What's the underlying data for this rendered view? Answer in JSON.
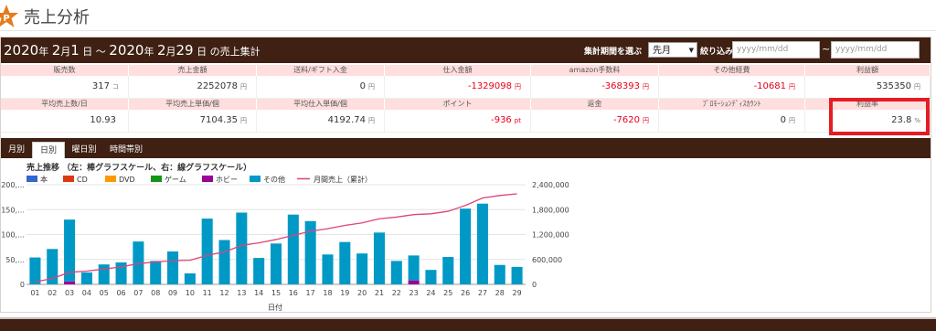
{
  "page": {
    "title": "売上分析",
    "logo_letter": "P"
  },
  "header": {
    "period": {
      "y1": "2020",
      "m1": "2",
      "d1": "1",
      "y2": "2020",
      "m2": "2",
      "d2": "29",
      "nen": "年",
      "gatsu": "月",
      "nichi": "日",
      "tilde": "～",
      "suffix": "の売上集計"
    },
    "period_select_label": "集計期間を選ぶ",
    "period_select_value": "先月",
    "filter_label": "絞り込み",
    "date_placeholder": "yyyy/mm/dd",
    "range_sep": "~"
  },
  "stats": {
    "row1": [
      {
        "label": "販売数",
        "value": "317",
        "unit": "コ",
        "neg": false
      },
      {
        "label": "売上金額",
        "value": "2252078",
        "unit": "円",
        "neg": false
      },
      {
        "label": "送料/ギフト入金",
        "value": "0",
        "unit": "円",
        "neg": false
      },
      {
        "label": "仕入金額",
        "value": "-1329098",
        "unit": "円",
        "neg": true
      },
      {
        "label": "amazon手数料",
        "value": "-368393",
        "unit": "円",
        "neg": true
      },
      {
        "label": "その他経費",
        "value": "-10681",
        "unit": "円",
        "neg": true
      },
      {
        "label": "利益額",
        "value": "535350",
        "unit": "円",
        "neg": false
      }
    ],
    "row2": [
      {
        "label": "平均売上数/日",
        "value": "10.93",
        "unit": "",
        "neg": false
      },
      {
        "label": "平均売上単価/個",
        "value": "7104.35",
        "unit": "円",
        "neg": false
      },
      {
        "label": "平均仕入単価/個",
        "value": "4192.74",
        "unit": "円",
        "neg": false
      },
      {
        "label": "ポイント",
        "value": "-936",
        "unit": "pt",
        "neg": true
      },
      {
        "label": "返金",
        "value": "-7620",
        "unit": "円",
        "neg": true
      },
      {
        "label": "ﾌﾟﾛﾓｰｼｮﾝﾃﾞｨｽｶｳﾝﾄ",
        "value": "0",
        "unit": "円",
        "neg": false
      },
      {
        "label": "利益率",
        "value": "23.8",
        "unit": "%",
        "neg": false
      }
    ]
  },
  "tabs": [
    "月別",
    "日別",
    "曜日別",
    "時間帯別"
  ],
  "active_tab": 1,
  "chart_data": {
    "type": "bar",
    "title": "売上推移 （左：棒グラフスケール、右：線グラフスケール）",
    "legend": [
      "本",
      "CD",
      "DVD",
      "ゲーム",
      "ホビー",
      "その他",
      "月間売上（累計）"
    ],
    "legend_colors": [
      "#3366cc",
      "#dc3912",
      "#ff9900",
      "#109618",
      "#990099",
      "#0099c6",
      "#dd4477"
    ],
    "xlabel": "日付",
    "categories": [
      "01",
      "02",
      "03",
      "04",
      "05",
      "06",
      "07",
      "08",
      "09",
      "10",
      "11",
      "12",
      "13",
      "14",
      "15",
      "16",
      "17",
      "18",
      "19",
      "20",
      "21",
      "22",
      "23",
      "24",
      "25",
      "26",
      "27",
      "28",
      "29"
    ],
    "left_axis": {
      "min": 0,
      "max": 200,
      "ticks": [
        "0",
        "50,…",
        "100,…",
        "150,…",
        "200,…"
      ]
    },
    "right_axis": {
      "min": 0,
      "max": 2400000,
      "ticks": [
        "0",
        "600,000",
        "1,200,000",
        "1,800,000",
        "2,400,000"
      ]
    },
    "series": [
      {
        "name": "その他",
        "axis": "left",
        "color": "#0099c6",
        "values": [
          54,
          71,
          124,
          24,
          40,
          44,
          86,
          47,
          66,
          22,
          132,
          89,
          144,
          53,
          82,
          140,
          127,
          60,
          85,
          62,
          104,
          47,
          50,
          29,
          55,
          152,
          162,
          39,
          35
        ]
      },
      {
        "name": "ホビー",
        "axis": "left",
        "color": "#990099",
        "values": [
          0,
          0,
          6,
          0,
          0,
          0,
          0,
          0,
          0,
          0,
          0,
          0,
          0,
          0,
          0,
          0,
          0,
          0,
          0,
          0,
          0,
          0,
          8,
          0,
          0,
          0,
          0,
          0,
          0
        ]
      },
      {
        "name": "月間売上（累計）",
        "axis": "right",
        "type": "line",
        "color": "#dd4477",
        "values": [
          60000,
          140000,
          290000,
          320000,
          370000,
          420000,
          500000,
          540000,
          570000,
          580000,
          700000,
          780000,
          940000,
          1000000,
          1080000,
          1180000,
          1280000,
          1340000,
          1420000,
          1480000,
          1580000,
          1620000,
          1680000,
          1700000,
          1760000,
          1900000,
          2080000,
          2140000,
          2180000
        ]
      }
    ]
  }
}
